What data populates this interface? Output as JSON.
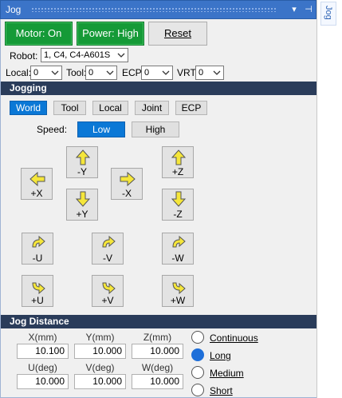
{
  "window": {
    "title": "Jog",
    "side_tab": "Jog"
  },
  "toolbar": {
    "motor_label": "Motor: On",
    "power_label": "Power: High",
    "reset_label": "Reset"
  },
  "selectors": {
    "robot_label": "Robot:",
    "robot_value": "1, C4, C4-A601S",
    "local_label": "Local:",
    "local_value": "0",
    "tool_label": "Tool:",
    "tool_value": "0",
    "ecp_label": "ECP:",
    "ecp_value": "0",
    "vrt_label": "VRT:",
    "vrt_value": "0"
  },
  "jogging": {
    "section_title": "Jogging",
    "modes": [
      "World",
      "Tool",
      "Local",
      "Joint",
      "ECP"
    ],
    "selected_mode": "World",
    "speed_label": "Speed:",
    "speed_options": [
      "Low",
      "High"
    ],
    "selected_speed": "Low",
    "buttons": {
      "neg_y": "-Y",
      "pos_x": "+X",
      "neg_x": "-X",
      "pos_y": "+Y",
      "pos_z": "+Z",
      "neg_z": "-Z",
      "neg_u": "-U",
      "neg_v": "-V",
      "neg_w": "-W",
      "pos_u": "+U",
      "pos_v": "+V",
      "pos_w": "+W"
    }
  },
  "distance": {
    "section_title": "Jog Distance",
    "x_label": "X(mm)",
    "x_value": "10.100",
    "y_label": "Y(mm)",
    "y_value": "10.000",
    "z_label": "Z(mm)",
    "z_value": "10.000",
    "u_label": "U(deg)",
    "u_value": "10.000",
    "v_label": "V(deg)",
    "v_value": "10.000",
    "w_label": "W(deg)",
    "w_value": "10.000",
    "options": [
      "Continuous",
      "Long",
      "Medium",
      "Short"
    ],
    "selected_option": "Long"
  },
  "colors": {
    "title_bar": "#3b74c8",
    "section_header": "#2a3c5a",
    "status_green": "#159a37",
    "selected_blue": "#0b78d6",
    "arrow_yellow": "#f5e63a"
  }
}
